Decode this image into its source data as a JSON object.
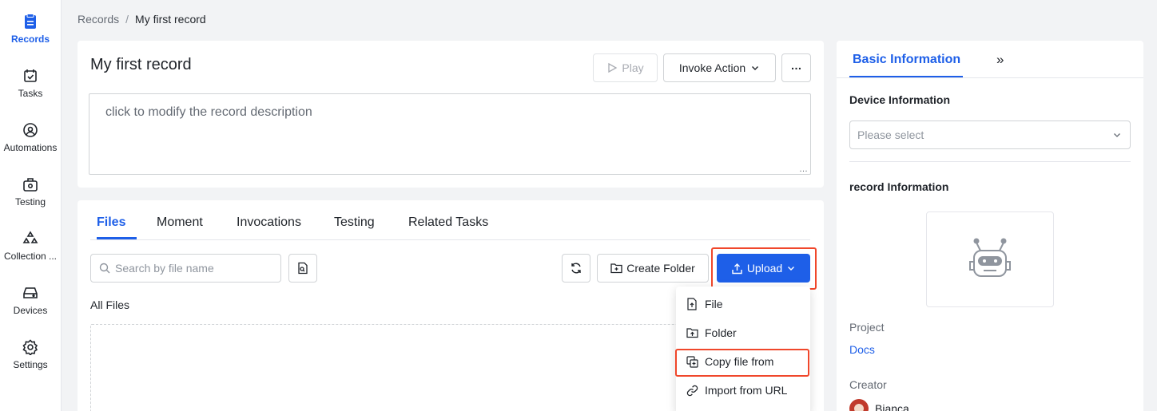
{
  "sidebar": {
    "items": [
      {
        "label": "Records",
        "icon": "records-icon",
        "active": true
      },
      {
        "label": "Tasks",
        "icon": "tasks-icon"
      },
      {
        "label": "Automations",
        "icon": "automations-icon"
      },
      {
        "label": "Testing",
        "icon": "testing-icon"
      },
      {
        "label": "Collection ...",
        "icon": "collection-icon"
      },
      {
        "label": "Devices",
        "icon": "devices-icon"
      },
      {
        "label": "Settings",
        "icon": "settings-icon"
      }
    ]
  },
  "breadcrumb": {
    "root": "Records",
    "separator": "/",
    "current": "My first record"
  },
  "record": {
    "title": "My first record",
    "play_label": "Play",
    "invoke_label": "Invoke Action",
    "more_label": "…",
    "description": "click to modify the record description"
  },
  "files": {
    "tabs": [
      "Files",
      "Moment",
      "Invocations",
      "Testing",
      "Related Tasks"
    ],
    "active_tab": "Files",
    "search_placeholder": "Search by file name",
    "create_folder_label": "Create Folder",
    "upload_label": "Upload",
    "all_files_label": "All Files",
    "upload_menu": [
      {
        "label": "File",
        "icon": "file-upload-icon"
      },
      {
        "label": "Folder",
        "icon": "folder-upload-icon"
      },
      {
        "label": "Copy file from",
        "icon": "copy-file-icon",
        "highlighted": true
      },
      {
        "label": "Import from URL",
        "icon": "link-icon"
      }
    ]
  },
  "right_panel": {
    "tab_label": "Basic Information",
    "expand_label": "»",
    "device_info_label": "Device Information",
    "device_select_placeholder": "Please select",
    "record_info_label": "record Information",
    "project_label": "Project",
    "project_value": "Docs",
    "creator_label": "Creator",
    "creator_name": "Bianca"
  },
  "colors": {
    "accent": "#1e5fe8",
    "highlight_frame": "#f0472b",
    "background": "#f2f3f5"
  }
}
